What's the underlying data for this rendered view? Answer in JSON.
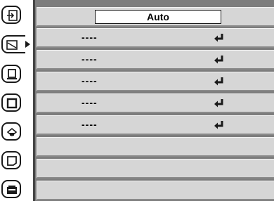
{
  "sidebar": {
    "tabs": [
      {
        "name": "input-icon"
      },
      {
        "name": "picture-adjust-icon",
        "active": true
      },
      {
        "name": "screen-icon"
      },
      {
        "name": "image-select-icon"
      },
      {
        "name": "color-icon"
      },
      {
        "name": "setting-icon"
      },
      {
        "name": "info-icon"
      }
    ]
  },
  "main": {
    "mode_value": "Auto",
    "rows": [
      {
        "label": "----"
      },
      {
        "label": "----"
      },
      {
        "label": "----"
      },
      {
        "label": "----"
      },
      {
        "label": "----"
      }
    ]
  }
}
